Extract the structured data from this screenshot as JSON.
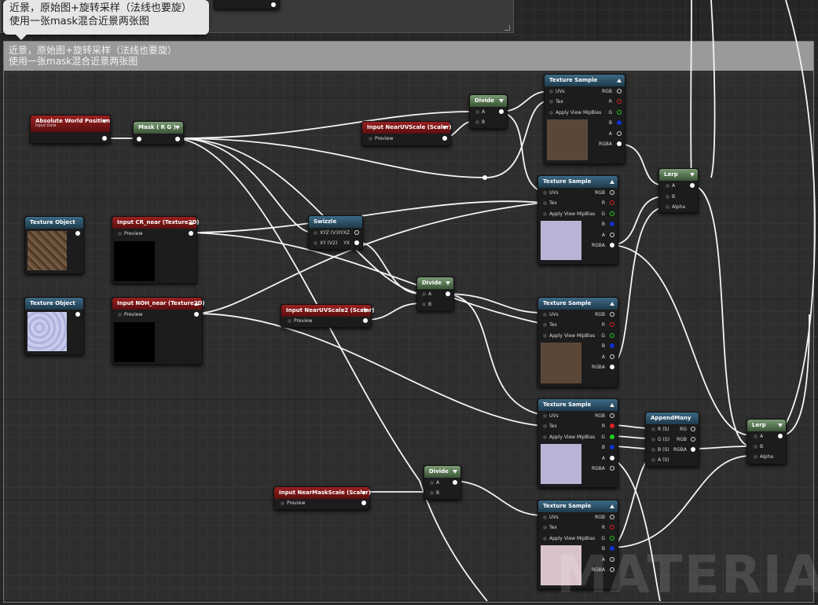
{
  "tooltip": {
    "line1": "近景，原始图+旋转采样（法线也要旋）",
    "line2": "使用一张mask混合近景两张图"
  },
  "comment": {
    "line1": "近景，原始图+旋转采样（法线也要旋）",
    "line2": "使用一张mask混合近景两张图"
  },
  "watermark": "MATERIAL F",
  "pins": {
    "uvs": "UVs",
    "tex": "Tex",
    "avm": "Apply View MipBias",
    "rgb": "RGB",
    "r": "R",
    "g": "G",
    "b": "B",
    "a": "A",
    "rgba": "RGBA",
    "A": "A",
    "B": "B",
    "alpha": "Alpha",
    "preview": "Preview",
    "xyz": "XYZ (V3)",
    "yxz": "YXZ",
    "xy": "XY (V2)",
    "yx": "YX",
    "rs": "R (S)",
    "gs": "G (S)",
    "bs": "B (S)",
    "as": "A (S)",
    "rg": "RG"
  },
  "nodes": {
    "abs_world_pos": {
      "title": "Absolute World Position",
      "sub": "Input Data"
    },
    "mask": {
      "title": "Mask ( R G )"
    },
    "divide1": {
      "title": "Divide"
    },
    "near_uvscale": {
      "title": "Input NearUVScale (Scalar)"
    },
    "tex_obj1": {
      "title": "Texture Object"
    },
    "cr_near": {
      "title": "Input CR_near (Texture2D)"
    },
    "swizzle": {
      "title": "Swizzle"
    },
    "tex_obj2": {
      "title": "Texture Object"
    },
    "noh_near": {
      "title": "Input NOH_near (Texture2D)"
    },
    "near_uvscale2": {
      "title": "Input NearUVScale2 (Scalar)"
    },
    "divide2": {
      "title": "Divide"
    },
    "divide3": {
      "title": "Divide"
    },
    "near_mask_scale": {
      "title": "Input NearMaskScale (Scalar)"
    },
    "ts1": {
      "title": "Texture Sample"
    },
    "ts2": {
      "title": "Texture Sample"
    },
    "ts3": {
      "title": "Texture Sample"
    },
    "ts4": {
      "title": "Texture Sample"
    },
    "ts5": {
      "title": "Texture Sample"
    },
    "lerp1": {
      "title": "Lerp"
    },
    "lerp2": {
      "title": "Lerp"
    },
    "append": {
      "title": "AppendMany"
    }
  },
  "thumb_colors": {
    "brown": "#5b4738",
    "lavender": "#b8b4d8",
    "pink": "#d8c4c8",
    "black": "#000000",
    "rock": "#6a5038",
    "normal": "#c8ccec"
  }
}
